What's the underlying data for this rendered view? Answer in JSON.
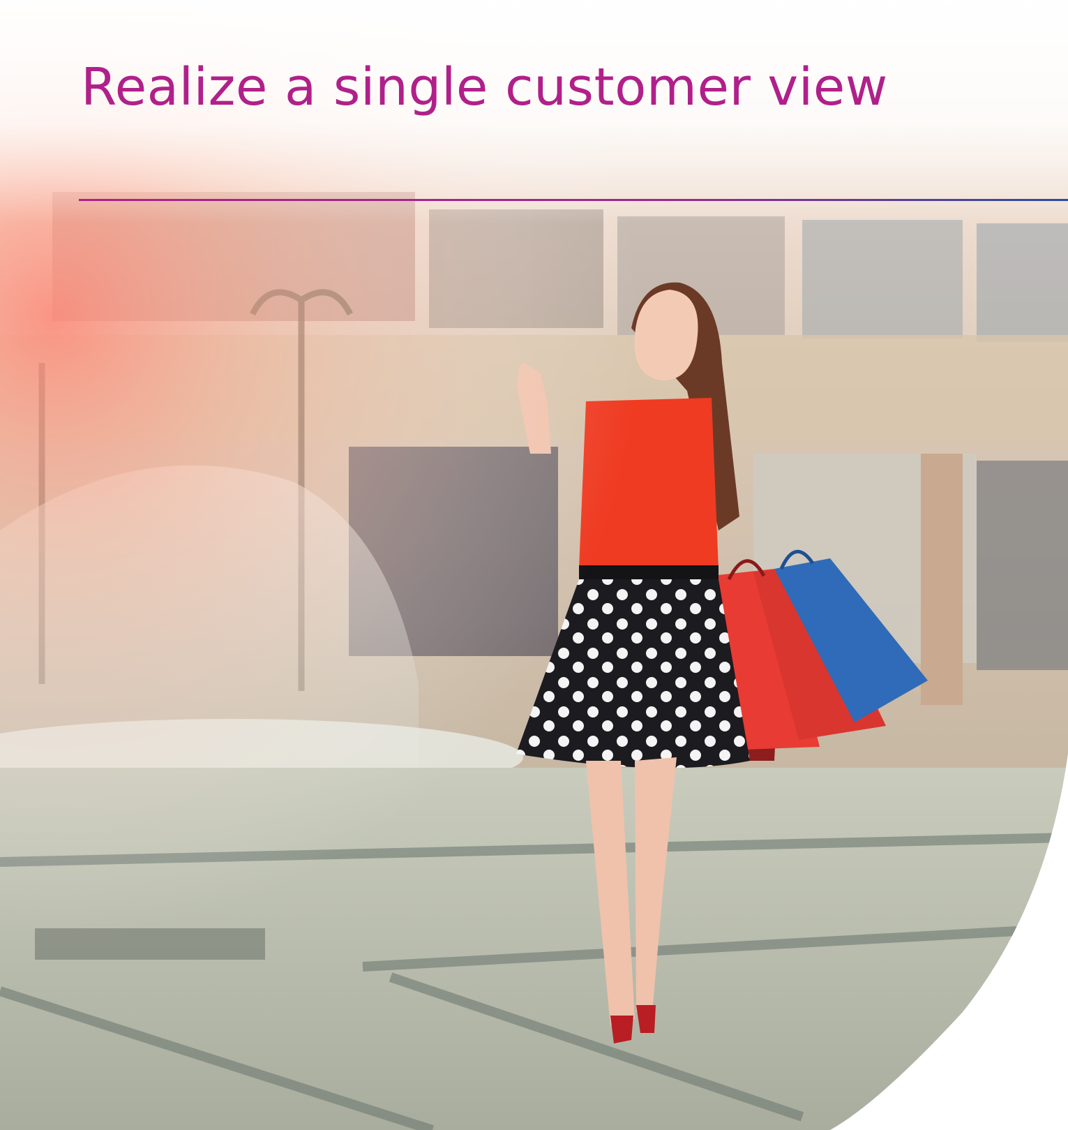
{
  "heading": {
    "text": "Realize a single customer view"
  },
  "colors": {
    "title": "#b0208a",
    "rule_start": "#b0208a",
    "rule_end": "#2a4da0",
    "top_glow": "#ffffff",
    "pavement": "#b9bfae",
    "building": "#d9c7b2",
    "top_color": "#ef3b22",
    "skirt": "#1c1b20",
    "bag_red": "#e83b33",
    "bag_blue": "#2f6bb8",
    "page_background": "#ffffff"
  },
  "photo": {
    "subject": "woman walking with shopping bags"
  }
}
